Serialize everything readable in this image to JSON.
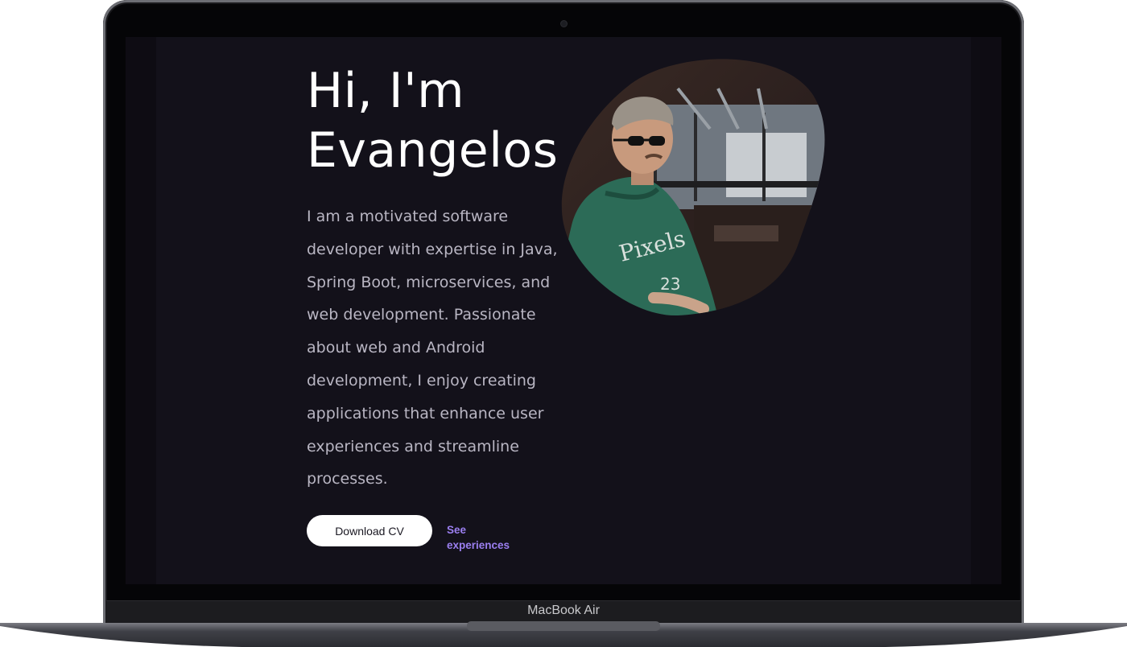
{
  "hero": {
    "greeting": "Hi, I'm",
    "name": "Evangelos",
    "intro": "I am a motivated software developer with expertise in Java, Spring Boot, microservices, and web development. Passionate about web and Android development, I enjoy creating applications that enhance user experiences and streamline processes.",
    "download_cv_label": "Download CV",
    "see_experiences_label": "See experiences"
  },
  "device": {
    "model_label": "MacBook Air"
  },
  "colors": {
    "background": "#13111a",
    "accent": "#9b7ff0",
    "text": "#ffffff",
    "muted_text": "#b9b6c3"
  }
}
